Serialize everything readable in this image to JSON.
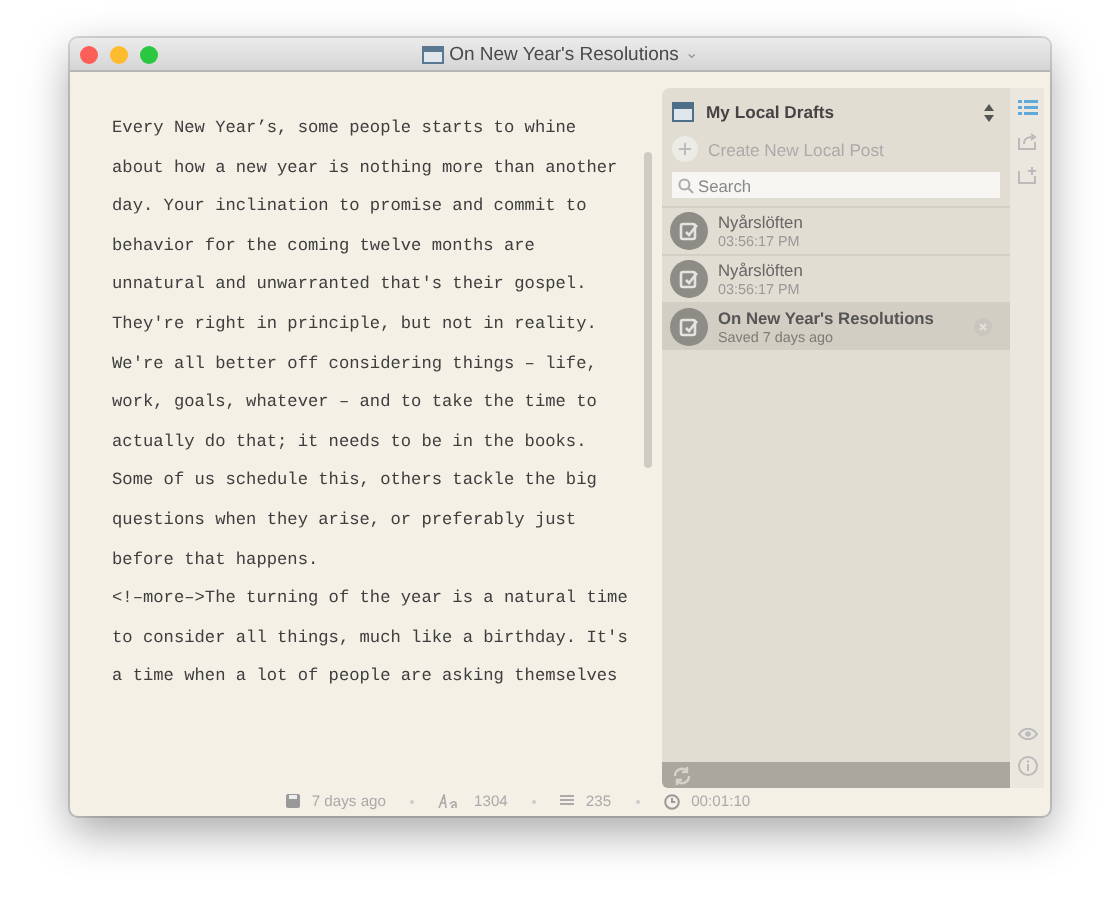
{
  "window": {
    "title": "On New Year's Resolutions",
    "caret": "⌄"
  },
  "editor": {
    "lines": [
      "Every New Year’s, some people starts to whine",
      "about how a new year is nothing more than another",
      "day. Your inclination to promise and commit to",
      "behavior for the coming twelve months are",
      "unnatural and unwarranted that's their gospel.",
      "They're right in principle, but not in reality.",
      "We're all better off considering things – life,",
      "work, goals, whatever – and to take the time to",
      "actually do that; it needs to be in the books.",
      "Some of us schedule this, others tackle the big",
      "questions when they arise, or preferably just",
      "before that happens.",
      "<!–more–>The turning of the year is a natural time",
      "to consider all things, much like a birthday. It's",
      "a time when a lot of people are asking themselves"
    ]
  },
  "drafts": {
    "title": "My Local Drafts",
    "create_label": "Create New Local Post",
    "search": {
      "placeholder": "Search"
    },
    "posts": [
      {
        "title": "Nyårslöften",
        "subtitle": "03:56:17 PM",
        "selected": false
      },
      {
        "title": "Nyårslöften",
        "subtitle": "03:56:17 PM",
        "selected": false
      },
      {
        "title": "On New Year's Resolutions",
        "subtitle": "Saved 7 days ago",
        "selected": true
      }
    ]
  },
  "status_bar": {
    "saved": "7 days ago",
    "characters": "1304",
    "words": "235",
    "time": "00:01:10"
  }
}
